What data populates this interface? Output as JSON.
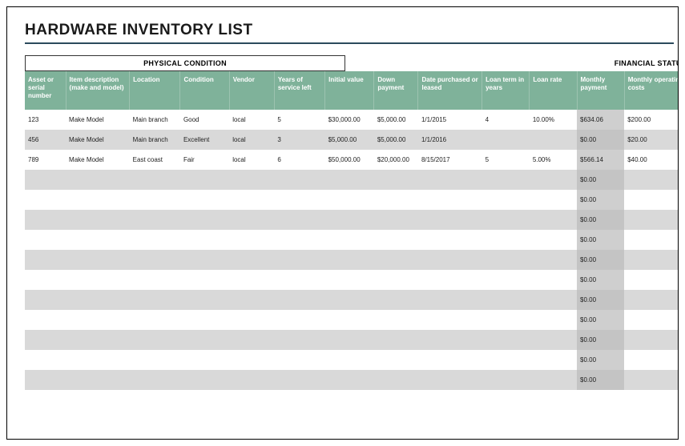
{
  "title": "HARDWARE INVENTORY LIST",
  "sections": {
    "physical": "PHYSICAL CONDITION",
    "financial": "FINANCIAL STATUS"
  },
  "columns": [
    "Asset or serial number",
    "Item description (make and model)",
    "Location",
    "Condition",
    "Vendor",
    "Years of service left",
    "Initial value",
    "Down payment",
    "Date purchased or leased",
    "Loan term in years",
    "Loan rate",
    "Monthly payment",
    "Monthly operating costs"
  ],
  "rows": [
    {
      "asset": "123",
      "desc": "Make Model",
      "location": "Main branch",
      "condition": "Good",
      "vendor": "local",
      "years": "5",
      "initial": "$30,000.00",
      "down": "$5,000.00",
      "date": "1/1/2015",
      "term": "4",
      "rate": "10.00%",
      "monthly": "$634.06",
      "opcost": "$200.00"
    },
    {
      "asset": "456",
      "desc": "Make Model",
      "location": "Main branch",
      "condition": "Excellent",
      "vendor": "local",
      "years": "3",
      "initial": "$5,000.00",
      "down": "$5,000.00",
      "date": "1/1/2016",
      "term": "",
      "rate": "",
      "monthly": "$0.00",
      "opcost": "$20.00"
    },
    {
      "asset": "789",
      "desc": "Make Model",
      "location": "East coast",
      "condition": "Fair",
      "vendor": "local",
      "years": "6",
      "initial": "$50,000.00",
      "down": "$20,000.00",
      "date": "8/15/2017",
      "term": "5",
      "rate": "5.00%",
      "monthly": "$566.14",
      "opcost": "$40.00"
    },
    {
      "asset": "",
      "desc": "",
      "location": "",
      "condition": "",
      "vendor": "",
      "years": "",
      "initial": "",
      "down": "",
      "date": "",
      "term": "",
      "rate": "",
      "monthly": "$0.00",
      "opcost": ""
    },
    {
      "asset": "",
      "desc": "",
      "location": "",
      "condition": "",
      "vendor": "",
      "years": "",
      "initial": "",
      "down": "",
      "date": "",
      "term": "",
      "rate": "",
      "monthly": "$0.00",
      "opcost": ""
    },
    {
      "asset": "",
      "desc": "",
      "location": "",
      "condition": "",
      "vendor": "",
      "years": "",
      "initial": "",
      "down": "",
      "date": "",
      "term": "",
      "rate": "",
      "monthly": "$0.00",
      "opcost": ""
    },
    {
      "asset": "",
      "desc": "",
      "location": "",
      "condition": "",
      "vendor": "",
      "years": "",
      "initial": "",
      "down": "",
      "date": "",
      "term": "",
      "rate": "",
      "monthly": "$0.00",
      "opcost": ""
    },
    {
      "asset": "",
      "desc": "",
      "location": "",
      "condition": "",
      "vendor": "",
      "years": "",
      "initial": "",
      "down": "",
      "date": "",
      "term": "",
      "rate": "",
      "monthly": "$0.00",
      "opcost": ""
    },
    {
      "asset": "",
      "desc": "",
      "location": "",
      "condition": "",
      "vendor": "",
      "years": "",
      "initial": "",
      "down": "",
      "date": "",
      "term": "",
      "rate": "",
      "monthly": "$0.00",
      "opcost": ""
    },
    {
      "asset": "",
      "desc": "",
      "location": "",
      "condition": "",
      "vendor": "",
      "years": "",
      "initial": "",
      "down": "",
      "date": "",
      "term": "",
      "rate": "",
      "monthly": "$0.00",
      "opcost": ""
    },
    {
      "asset": "",
      "desc": "",
      "location": "",
      "condition": "",
      "vendor": "",
      "years": "",
      "initial": "",
      "down": "",
      "date": "",
      "term": "",
      "rate": "",
      "monthly": "$0.00",
      "opcost": ""
    },
    {
      "asset": "",
      "desc": "",
      "location": "",
      "condition": "",
      "vendor": "",
      "years": "",
      "initial": "",
      "down": "",
      "date": "",
      "term": "",
      "rate": "",
      "monthly": "$0.00",
      "opcost": ""
    },
    {
      "asset": "",
      "desc": "",
      "location": "",
      "condition": "",
      "vendor": "",
      "years": "",
      "initial": "",
      "down": "",
      "date": "",
      "term": "",
      "rate": "",
      "monthly": "$0.00",
      "opcost": ""
    },
    {
      "asset": "",
      "desc": "",
      "location": "",
      "condition": "",
      "vendor": "",
      "years": "",
      "initial": "",
      "down": "",
      "date": "",
      "term": "",
      "rate": "",
      "monthly": "$0.00",
      "opcost": ""
    }
  ]
}
